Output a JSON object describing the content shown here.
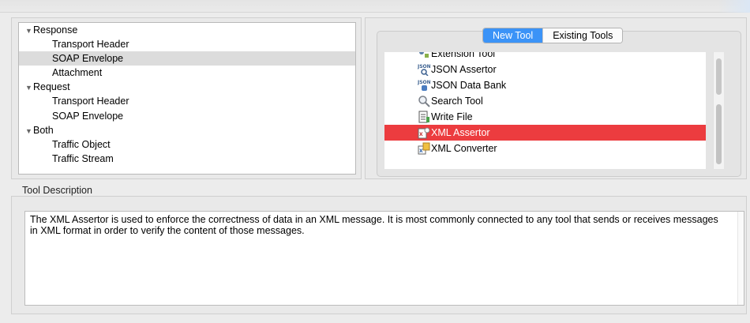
{
  "tree": {
    "items": [
      {
        "label": "Response",
        "kind": "category"
      },
      {
        "label": "Transport Header",
        "kind": "child"
      },
      {
        "label": "SOAP Envelope",
        "kind": "child",
        "selected": true
      },
      {
        "label": "Attachment",
        "kind": "child"
      },
      {
        "label": "Request",
        "kind": "category"
      },
      {
        "label": "Transport Header",
        "kind": "child"
      },
      {
        "label": "SOAP Envelope",
        "kind": "child"
      },
      {
        "label": "Both",
        "kind": "category"
      },
      {
        "label": "Traffic Object",
        "kind": "child"
      },
      {
        "label": "Traffic Stream",
        "kind": "child"
      }
    ]
  },
  "tabs": {
    "new_tool": "New Tool",
    "existing_tools": "Existing Tools"
  },
  "tools": {
    "items": [
      {
        "label": "Extension Tool",
        "icon": "extension-tool-icon"
      },
      {
        "label": "JSON Assertor",
        "icon": "json-assertor-icon"
      },
      {
        "label": "JSON Data Bank",
        "icon": "json-data-bank-icon"
      },
      {
        "label": "Search Tool",
        "icon": "search-icon"
      },
      {
        "label": "Write File",
        "icon": "write-file-icon"
      },
      {
        "label": "XML Assertor",
        "icon": "xml-assertor-icon",
        "selected": true
      },
      {
        "label": "XML Converter",
        "icon": "xml-converter-icon"
      }
    ]
  },
  "description": {
    "label": "Tool Description",
    "text": "The XML Assertor is used to enforce the correctness of data in an XML message. It is most commonly connected to any tool that sends or receives messages in XML format in order to verify the content of those messages."
  },
  "colors": {
    "selection_red": "#ec3c3f",
    "segment_blue": "#3b93f7",
    "tree_selection": "#dcdcdc"
  }
}
